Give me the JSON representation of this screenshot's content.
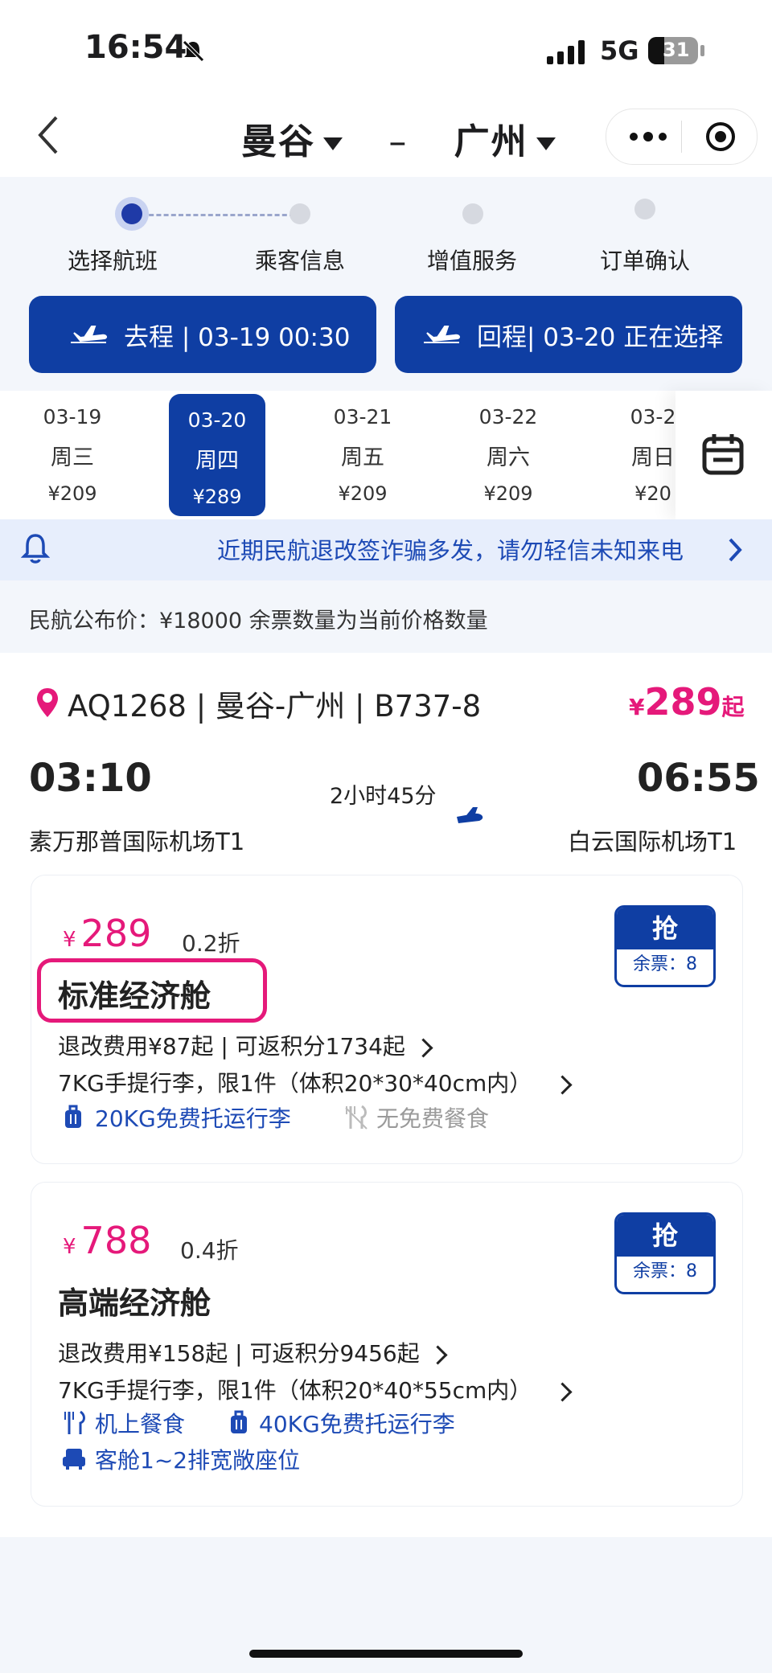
{
  "status_bar": {
    "time": "16:54",
    "network": "5G",
    "battery": "31"
  },
  "header": {
    "from_city": "曼谷",
    "to_city": "广州",
    "separator": "–"
  },
  "steps": [
    {
      "label": "选择航班",
      "active": true
    },
    {
      "label": "乘客信息",
      "active": false
    },
    {
      "label": "增值服务",
      "active": false
    },
    {
      "label": "订单确认",
      "active": false
    }
  ],
  "trips": {
    "outbound": "去程 | 03-19 00:30",
    "return": "回程| 03-20 正在选择"
  },
  "dates": [
    {
      "date": "03-19",
      "weekday": "周三",
      "price": "¥209",
      "selected": false
    },
    {
      "date": "03-20",
      "weekday": "周四",
      "price": "¥289",
      "selected": true
    },
    {
      "date": "03-21",
      "weekday": "周五",
      "price": "¥209",
      "selected": false
    },
    {
      "date": "03-22",
      "weekday": "周六",
      "price": "¥209",
      "selected": false
    },
    {
      "date": "03-2",
      "weekday": "周日",
      "price": "¥20",
      "selected": false
    }
  ],
  "notice": {
    "text": "近期民航退改签诈骗多发，请勿轻信未知来电"
  },
  "published_price": {
    "text": "民航公布价：¥18000   余票数量为当前价格数量"
  },
  "flight": {
    "info": "AQ1268 | 曼谷-广州 | B737-8",
    "price_currency": "¥",
    "price": "289",
    "price_suffix": "起",
    "depart_time": "03:10",
    "arrive_time": "06:55",
    "duration": "2小时45分",
    "depart_airport": "素万那普国际机场T1",
    "arrive_airport": "白云国际机场T1"
  },
  "cabins": [
    {
      "currency": "¥",
      "price": "289",
      "discount": "0.2折",
      "name": "标准经济舱",
      "refund": "退改费用¥87起 | 可返积分1734起",
      "carry_on": "7KG手提行李，限1件（体积20*30*40cm内）",
      "checked": "20KG免费托运行李",
      "meal": "无免费餐食",
      "grab_label": "抢",
      "tickets_left": "余票：8"
    },
    {
      "currency": "¥",
      "price": "788",
      "discount": "0.4折",
      "name": "高端经济舱",
      "refund": "退改费用¥158起 | 可返积分9456起",
      "carry_on": "7KG手提行李，限1件（体积20*40*55cm内）",
      "meal": "机上餐食",
      "checked": "40KG免费托运行李",
      "seat": "客舱1~2排宽敞座位",
      "grab_label": "抢",
      "tickets_left": "余票：8"
    }
  ],
  "colors": {
    "brand": "#0f3ea3",
    "price": "#e5197a",
    "link": "#1d4ab5"
  }
}
